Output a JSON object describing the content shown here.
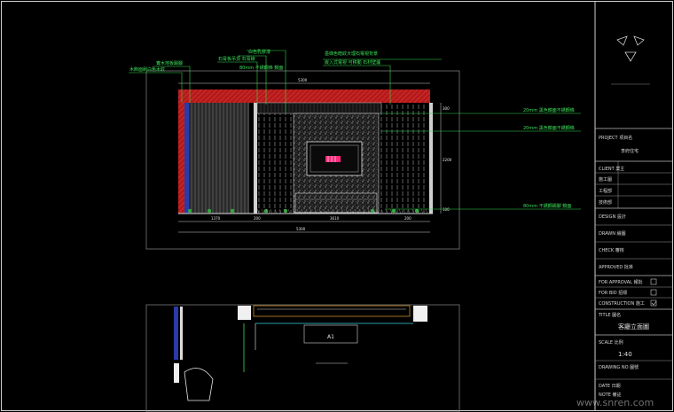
{
  "title_block": {
    "project_label": "PROJECT 項目名",
    "project_name": "李府住宅",
    "client_label": "CLIENT 業主",
    "designer_label": "DESIGN 設計",
    "drawn_label": "DRAWN 繪圖",
    "checked_label": "CHECK 審核",
    "approved_label": "APPROVED 批准",
    "scale_label": "SCALE 比例",
    "scale_value": "1:40",
    "drawing_no_label": "DRAWING NO 圖號",
    "date_label": "DATE 日期",
    "row_labels": [
      "施工圖",
      "工程部",
      "技術部"
    ],
    "checkbox_labels": [
      "FOR APPROVAL 報批",
      "FOR BID 招標",
      "CONSTRUCTION 施工"
    ],
    "title_label": "TITLE 圖名",
    "sheet_title": "客廳立面圖",
    "notes_label": "NOTE 備註"
  },
  "annotations": {
    "left": [
      "實木地板踢腳",
      "木飾面刷白色木紋"
    ],
    "center_top": [
      "白色乳膠漆",
      "石膏板吊頂 石膏線",
      "80mm 不銹鋼條 鏡面"
    ],
    "top_right": [
      "墨綠色暗紋大理石電視背景",
      "嵌入式電視 可移動 石材壁爐"
    ],
    "right": [
      "20mm 黑色鏡面不銹鋼條",
      "20mm 黑色鏡面不銹鋼條",
      "80mm 不銹鋼踢腳 鏡面"
    ]
  },
  "dimensions": {
    "top": [
      "5300"
    ],
    "bottom_segments": [
      "1370",
      "200",
      "3610",
      "200"
    ],
    "bottom_total": "5300",
    "right_heights": [
      "300",
      "2200",
      "100"
    ]
  },
  "plan_label": "A1",
  "watermark": "www.snren.com",
  "colors": {
    "background": "#000000",
    "line_white": "#d9d9d9",
    "annotation_green": "#33d64d",
    "section_red": "#c41e1e",
    "curtain_blue": "#2a3aa8",
    "tv_magenta": "#ff2a7a"
  }
}
